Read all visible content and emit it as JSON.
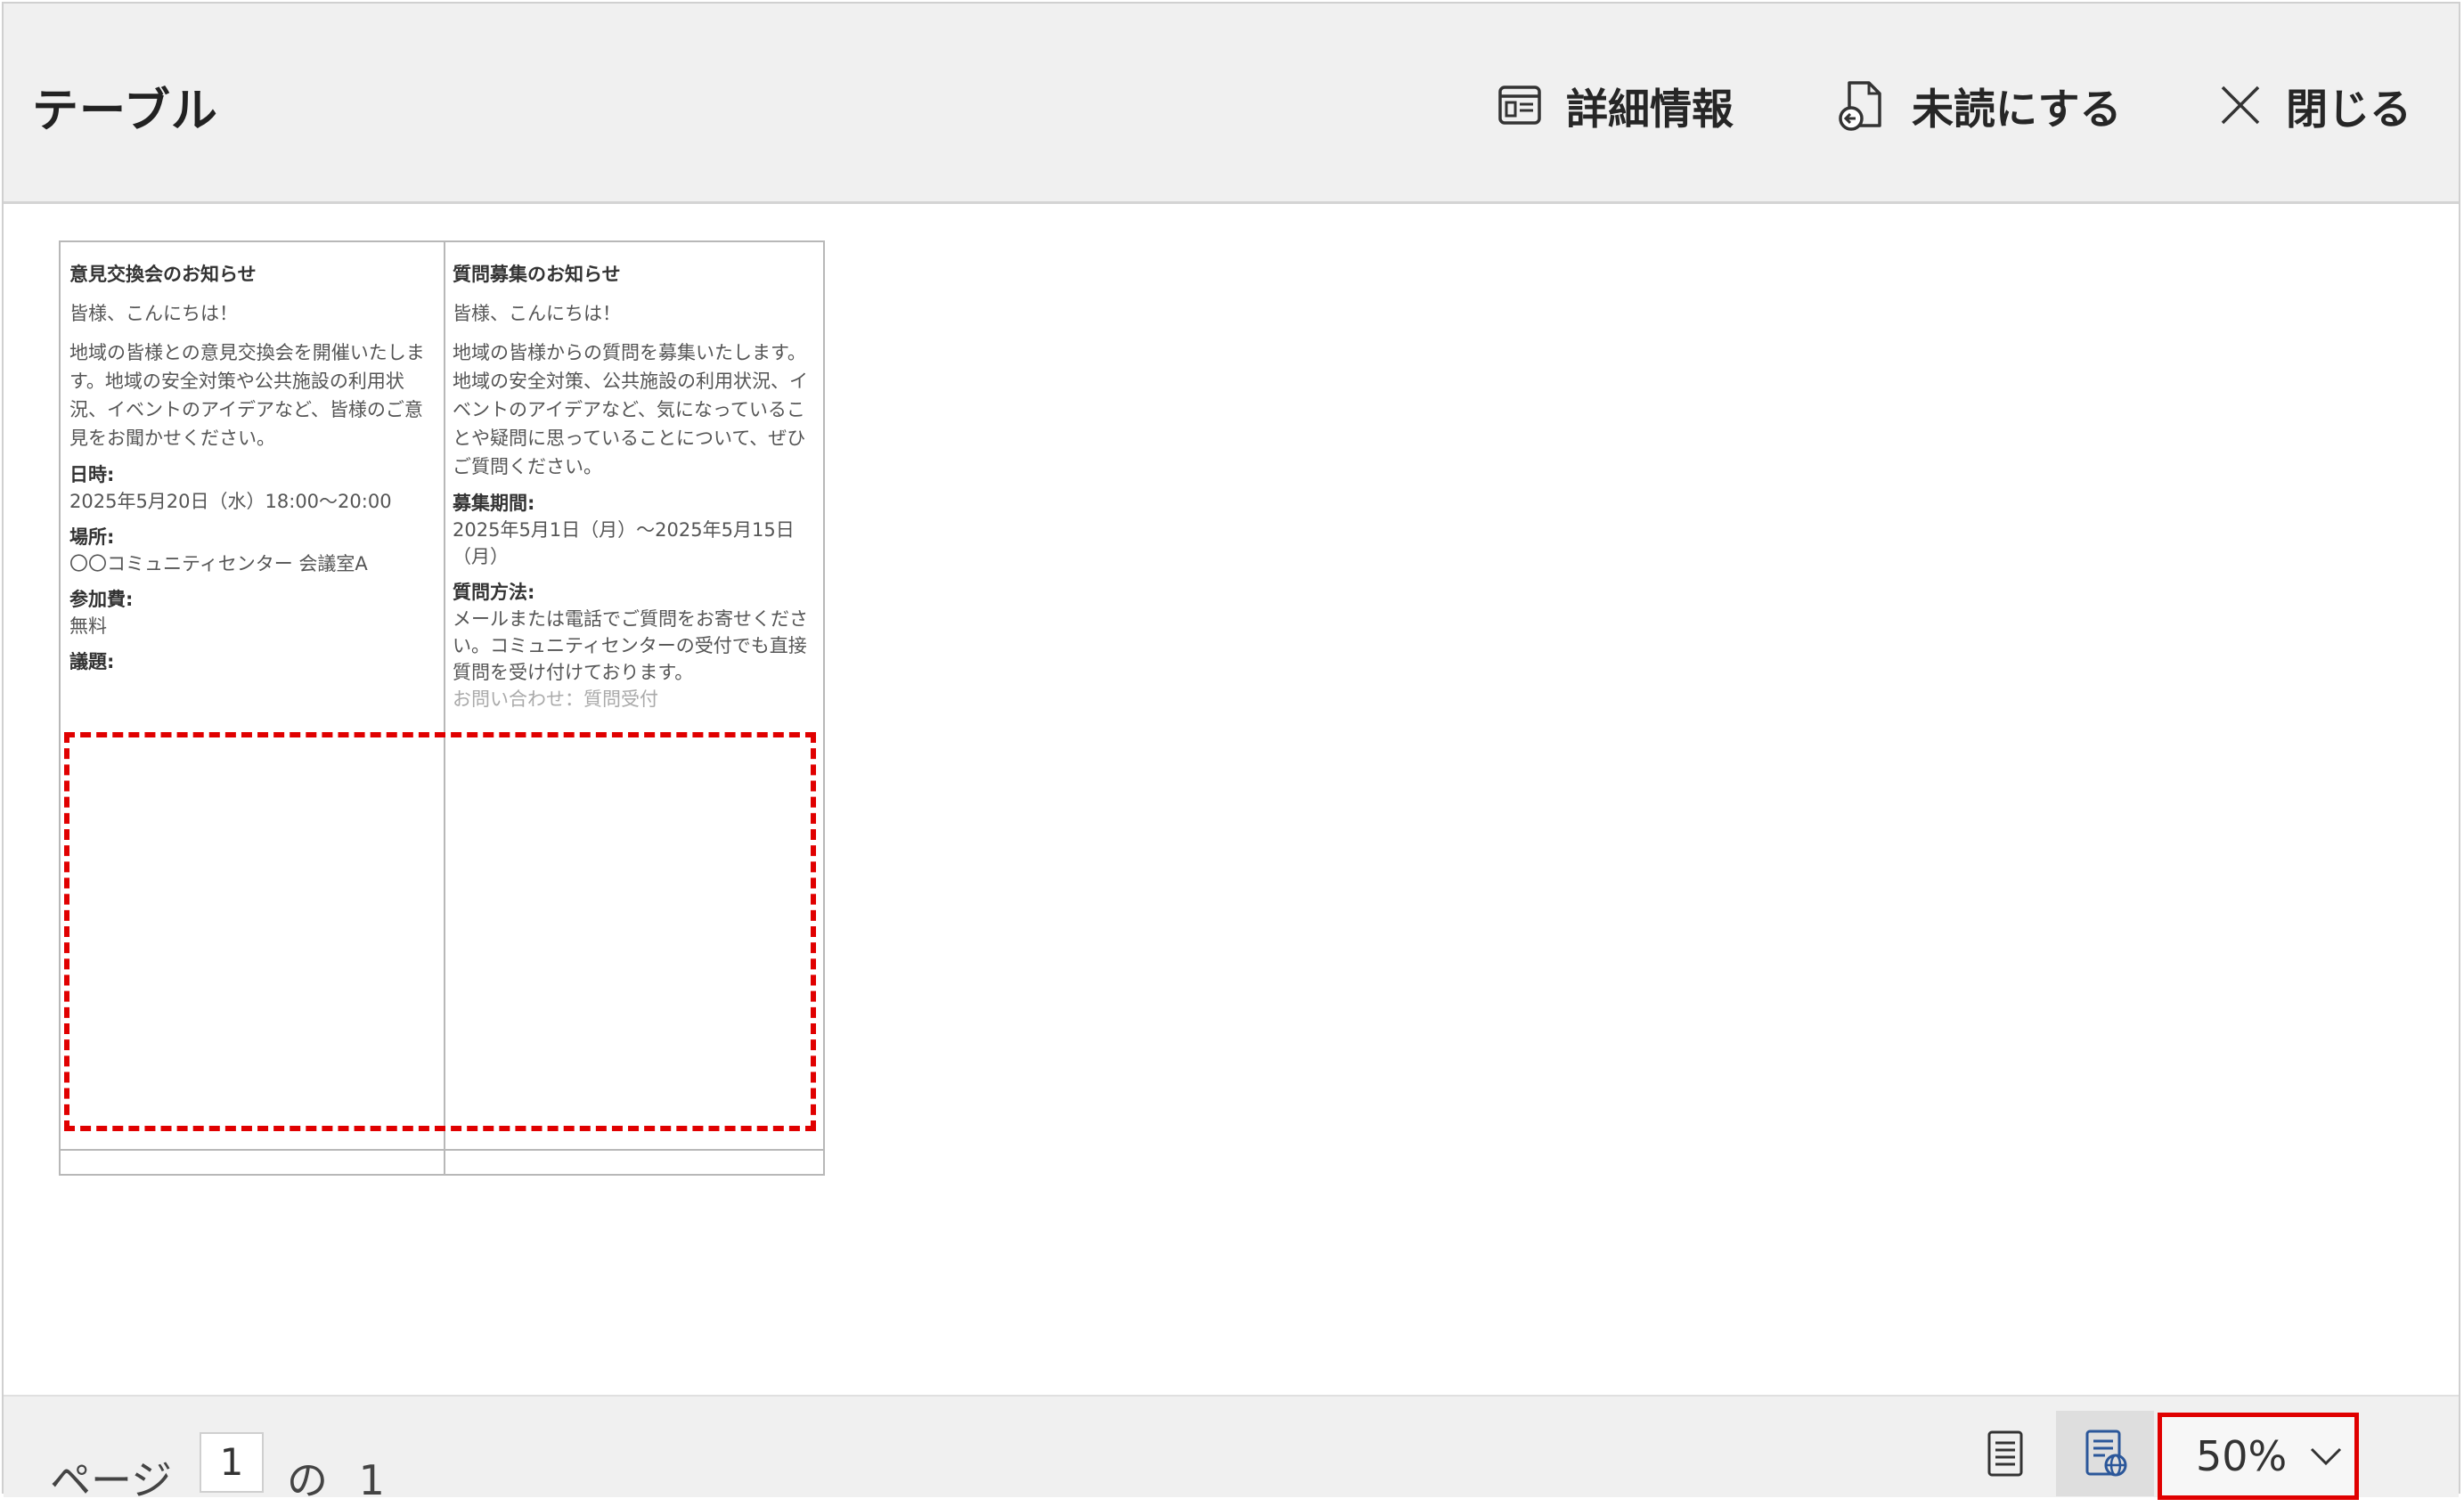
{
  "header": {
    "title": "テーブル",
    "details_label": "詳細情報",
    "unread_label": "未読にする",
    "close_label": "閉じる"
  },
  "preview": {
    "left": {
      "title": "意見交換会のお知らせ",
      "greeting": "皆様、こんにちは！",
      "body": "地域の皆様との意見交換会を開催いたします。地域の安全対策や公共施設の利用状況、イベントのアイデアなど、皆様のご意見をお聞かせください。",
      "date_label": "日時:",
      "date_value": "2025年5月20日（水）18:00〜20:00",
      "place_label": "場所:",
      "place_value": "〇〇コミュニティセンター 会議室A",
      "fee_label": "参加費:",
      "fee_value": "無料",
      "agenda_label": "議題:"
    },
    "right": {
      "title": "質問募集のお知らせ",
      "greeting": "皆様、こんにちは！",
      "body": "地域の皆様からの質問を募集いたします。地域の安全対策、公共施設の利用状況、イベントのアイデアなど、気になっていることや疑問に思っていることについて、ぜひご質問ください。",
      "period_label": "募集期間:",
      "period_value": "2025年5月1日（月）〜2025年5月15日（月）",
      "method_label": "質問方法:",
      "method_value": "メールまたは電話でご質問をお寄せください。コミュニティセンターの受付でも直接質問を受け付けております。",
      "cutoff_text": "お問い合わせ：質問受付"
    }
  },
  "footer": {
    "page_label": "ページ",
    "current_page": "1",
    "of_text": "の 1",
    "zoom": "50%"
  },
  "icons": {
    "details": "details-pane-icon",
    "unread": "mark-unread-icon",
    "close": "close-icon",
    "list_view": "list-view-icon",
    "web_view": "web-layout-icon",
    "chevron": "chevron-down-icon"
  },
  "colors": {
    "highlight": "#e00000",
    "header_bg": "#f0f0f0"
  }
}
